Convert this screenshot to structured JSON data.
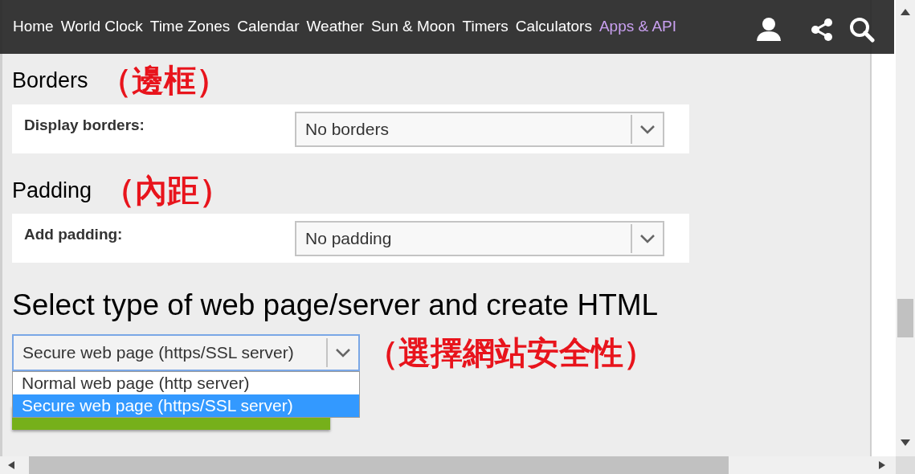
{
  "nav": {
    "items": [
      {
        "label": "Home",
        "selected": false
      },
      {
        "label": "World Clock",
        "selected": false
      },
      {
        "label": "Time Zones",
        "selected": false
      },
      {
        "label": "Calendar",
        "selected": false
      },
      {
        "label": "Weather",
        "selected": false
      },
      {
        "label": "Sun & Moon",
        "selected": false
      },
      {
        "label": "Timers",
        "selected": false
      },
      {
        "label": "Calculators",
        "selected": false
      },
      {
        "label": "Apps & API",
        "selected": true
      }
    ]
  },
  "sections": [
    {
      "heading": "Borders",
      "annotation": "（邊框）",
      "label": "Display borders:",
      "value": "No borders"
    },
    {
      "heading": "Padding",
      "annotation": "（內距）",
      "label": "Add padding:",
      "value": "No padding"
    }
  ],
  "server": {
    "heading": "Select type of web page/server and create HTML",
    "value": "Secure web page (https/SSL server)",
    "annotation": "（選擇網站安全性）",
    "expanded": true,
    "options": [
      {
        "label": "Normal web page (http server)",
        "selected": false
      },
      {
        "label": "Secure web page (https/SSL server)",
        "selected": true
      }
    ]
  }
}
